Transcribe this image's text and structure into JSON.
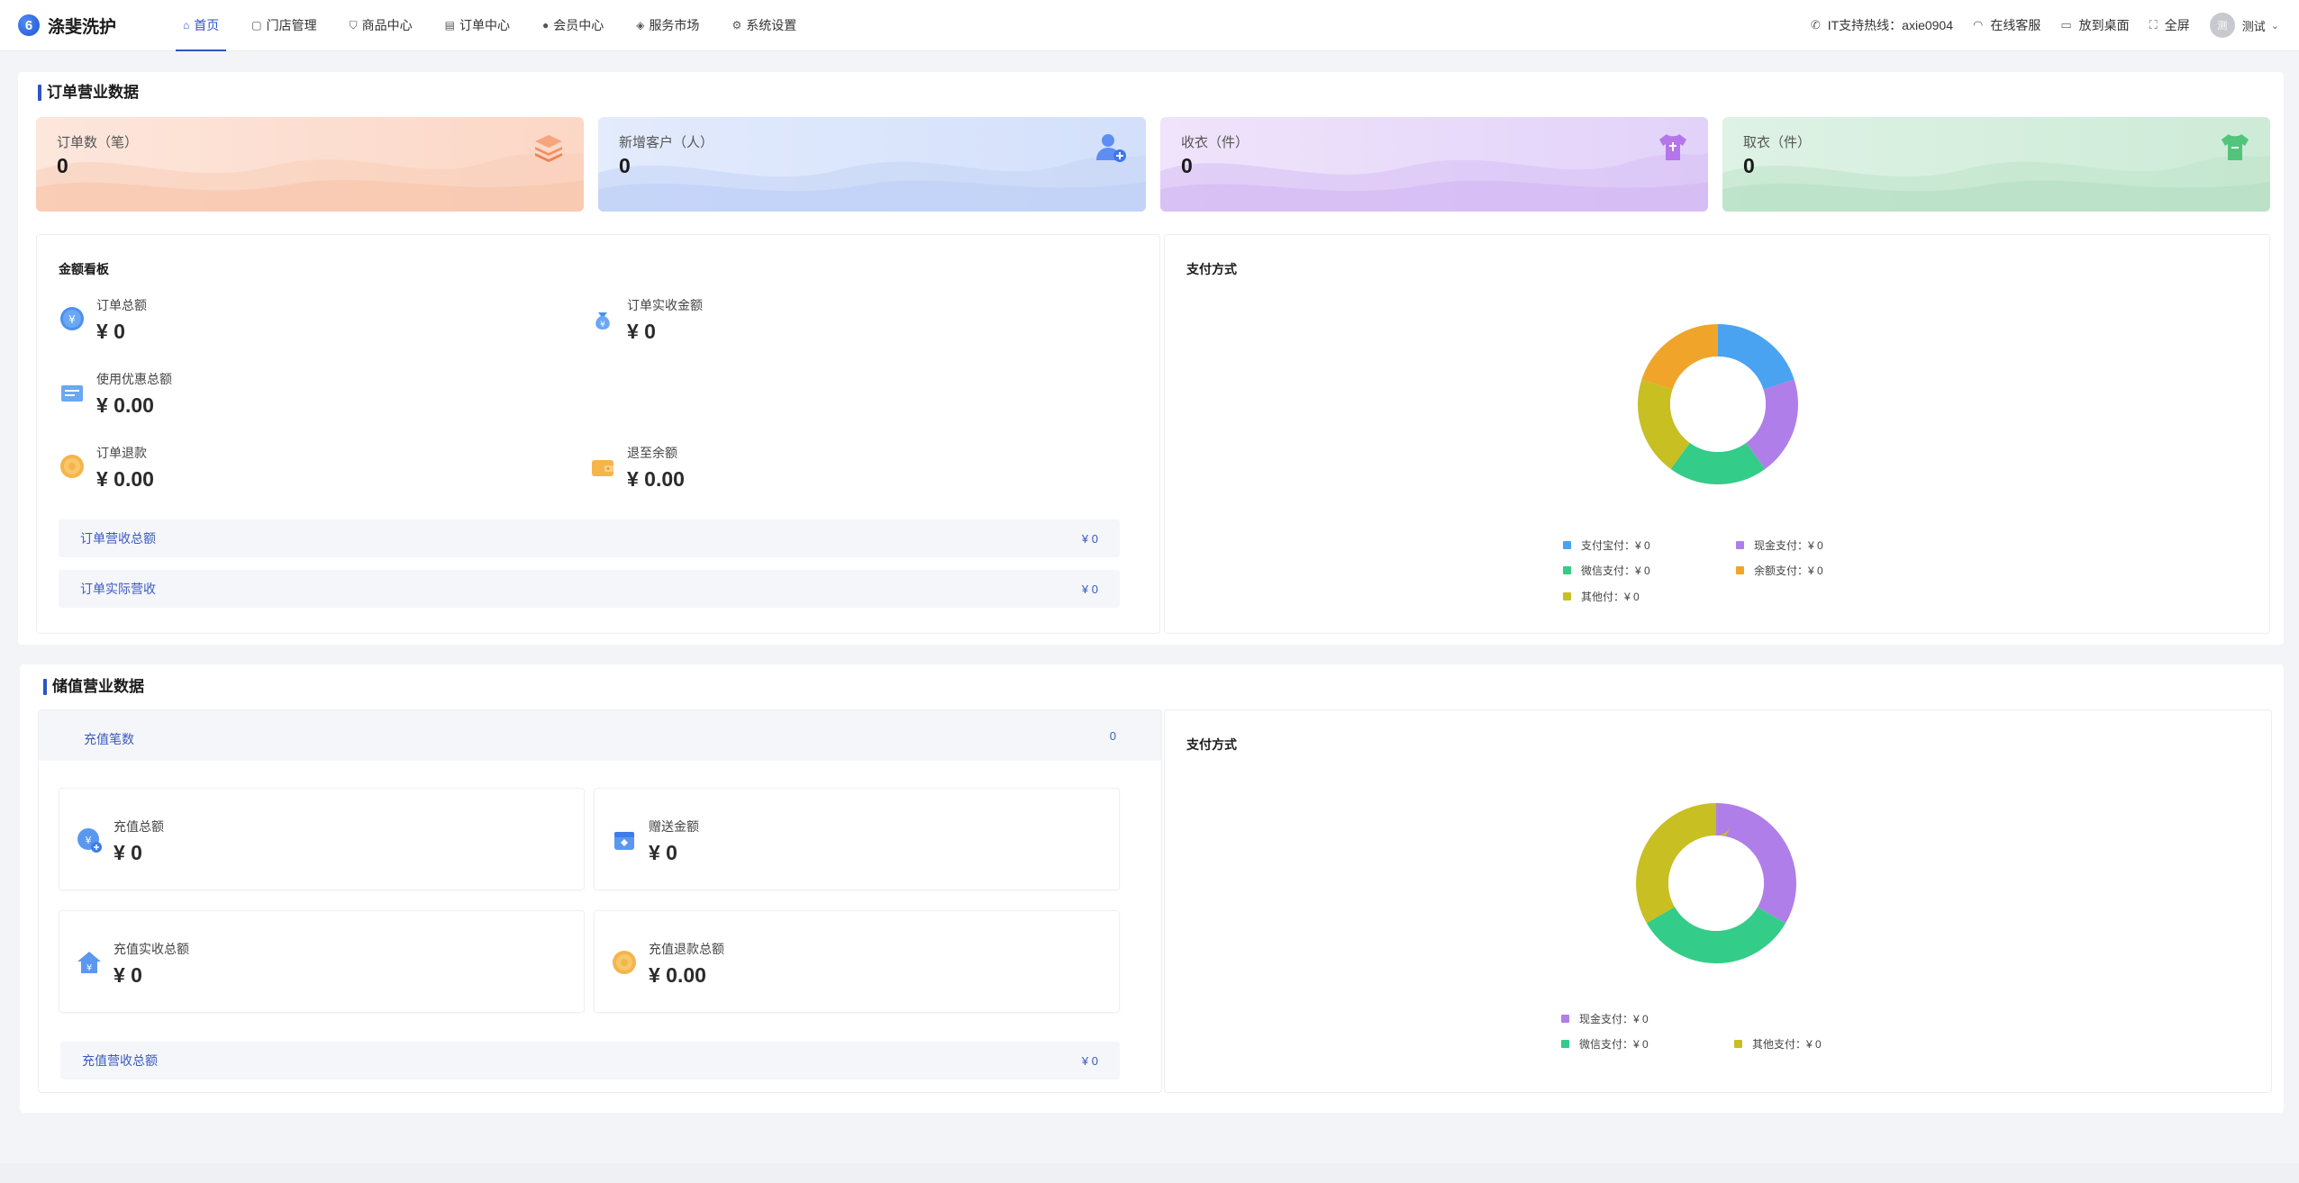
{
  "header": {
    "brand": "涤斐洗护",
    "brand_logo_letter": "6",
    "nav": [
      {
        "label": "首页",
        "icon": "home-icon",
        "glyph": "⌂",
        "active": true
      },
      {
        "label": "门店管理",
        "icon": "store-icon",
        "glyph": "▢",
        "active": false
      },
      {
        "label": "商品中心",
        "icon": "cart-icon",
        "glyph": "⛉",
        "active": false
      },
      {
        "label": "订单中心",
        "icon": "order-icon",
        "glyph": "▤",
        "active": false
      },
      {
        "label": "会员中心",
        "icon": "user-icon",
        "glyph": "●",
        "active": false
      },
      {
        "label": "服务市场",
        "icon": "market-icon",
        "glyph": "◈",
        "active": false
      },
      {
        "label": "系统设置",
        "icon": "gear-icon",
        "glyph": "⚙",
        "active": false
      }
    ],
    "tools": {
      "hotline": "IT支持热线：axie0904",
      "online_service": "在线客服",
      "desktop": "放到桌面",
      "fullscreen": "全屏"
    },
    "user": {
      "avatar_text": "测",
      "name": "测试"
    }
  },
  "order_section": {
    "title": "订单营业数据",
    "stats": [
      {
        "label": "订单数（笔）",
        "value": "0",
        "icon": "layers-icon"
      },
      {
        "label": "新增客户（人）",
        "value": "0",
        "icon": "add-user-icon"
      },
      {
        "label": "收衣（件）",
        "value": "0",
        "icon": "shirt-in-icon"
      },
      {
        "label": "取衣（件）",
        "value": "0",
        "icon": "shirt-out-icon"
      }
    ],
    "amount_board": {
      "title": "金额看板",
      "order_total": {
        "label": "订单总额",
        "value": "¥ 0"
      },
      "order_received": {
        "label": "订单实收金额",
        "value": "¥ 0"
      },
      "discount_total": {
        "label": "使用优惠总额",
        "value": "¥ 0.00"
      },
      "order_refund": {
        "label": "订单退款",
        "value": "¥ 0.00"
      },
      "refund_balance": {
        "label": "退至余额",
        "value": "¥ 0.00"
      },
      "revenue_total": {
        "label": "订单营收总额",
        "value": "¥ 0"
      },
      "revenue_actual": {
        "label": "订单实际营收",
        "value": "¥ 0"
      }
    },
    "payment": {
      "title": "支付方式",
      "legend": [
        {
          "label": "支付宝付：¥ 0",
          "color": "#4aa3f0"
        },
        {
          "label": "现金支付：¥ 0",
          "color": "#b07ee8"
        },
        {
          "label": "微信支付：¥ 0",
          "color": "#33cc88"
        },
        {
          "label": "余额支付：¥ 0",
          "color": "#f0a52a"
        },
        {
          "label": "其他付：¥ 0",
          "color": "#c8bf22"
        }
      ]
    }
  },
  "recharge_section": {
    "title": "储值营业数据",
    "count": {
      "label": "充值笔数",
      "value": "0"
    },
    "recharge_total": {
      "label": "充值总额",
      "value": "¥ 0"
    },
    "gift_amount": {
      "label": "赠送金额",
      "value": "¥ 0"
    },
    "recharge_received": {
      "label": "充值实收总额",
      "value": "¥ 0"
    },
    "recharge_refund": {
      "label": "充值退款总额",
      "value": "¥ 0.00"
    },
    "revenue_total": {
      "label": "充值营收总额",
      "value": "¥ 0"
    },
    "payment": {
      "title": "支付方式",
      "legend": [
        {
          "label": "现金支付：¥ 0",
          "color": "#b07ee8"
        },
        {
          "label": "微信支付：¥ 0",
          "color": "#33cc88"
        },
        {
          "label": "其他支付：¥ 0",
          "color": "#c8bf22"
        }
      ]
    }
  }
}
